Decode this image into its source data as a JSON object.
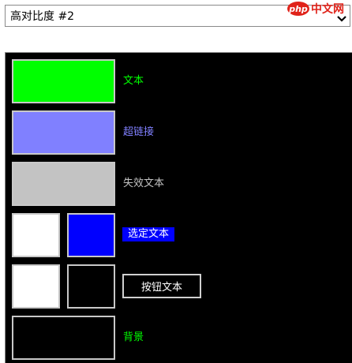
{
  "theme_select": {
    "value": "高对比度 #2",
    "icon": "chevron-down-icon"
  },
  "watermark": {
    "logo_text": "php",
    "site_text": "中文网"
  },
  "colors": {
    "text": "#00ff00",
    "hyperlink": "#8080ff",
    "disabled_text": "#c3c3c3",
    "selected_text_fg": "#ffffff",
    "selected_text_bg": "#0000ff",
    "button_text_fg": "#ffffff",
    "button_text_bg": "#000000",
    "background": "#000000"
  },
  "rows": {
    "text": {
      "label": "文本"
    },
    "hyperlink": {
      "label": "超链接"
    },
    "disabled_text": {
      "label": "失效文本"
    },
    "selected_text": {
      "label": "选定文本"
    },
    "button_text": {
      "label": "按钮文本"
    },
    "background": {
      "label": "背景"
    }
  }
}
